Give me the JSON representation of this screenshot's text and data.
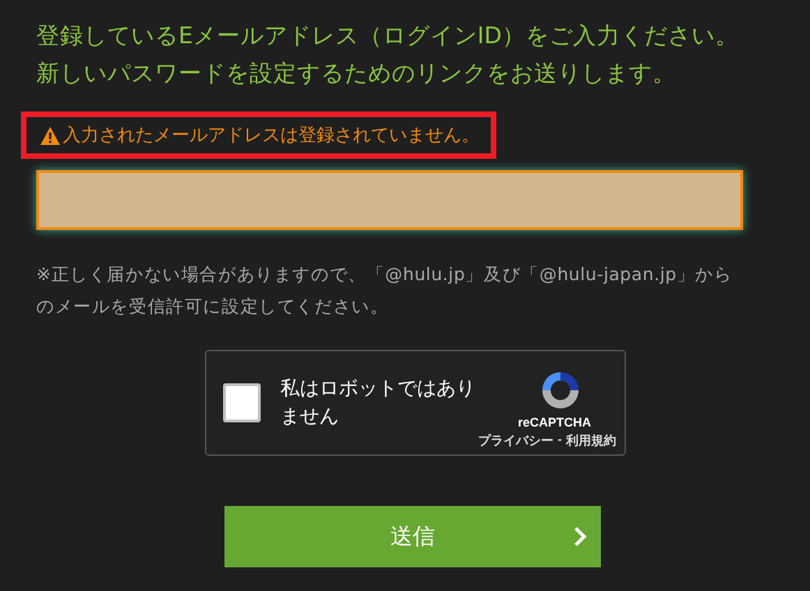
{
  "intro": [
    "登録しているEメールアドレス（ログインID）をご入力ください。",
    "新しいパスワードを設定するためのリンクをお送りします。"
  ],
  "error": {
    "message": "入力されたメールアドレスは登録されていません。",
    "highlighted": true
  },
  "email_field": {
    "invalid": true
  },
  "note": "※正しく届かない場合がありますので、「@hulu.jp」及び「@hulu-japan.jp」からのメールを受信許可に設定してください。",
  "captcha": {
    "label": "私はロボットではありません",
    "checked": false,
    "brand": "reCAPTCHA",
    "links": [
      "プライバシー",
      "-",
      "利用規約"
    ]
  },
  "submit": {
    "label": "送信"
  }
}
